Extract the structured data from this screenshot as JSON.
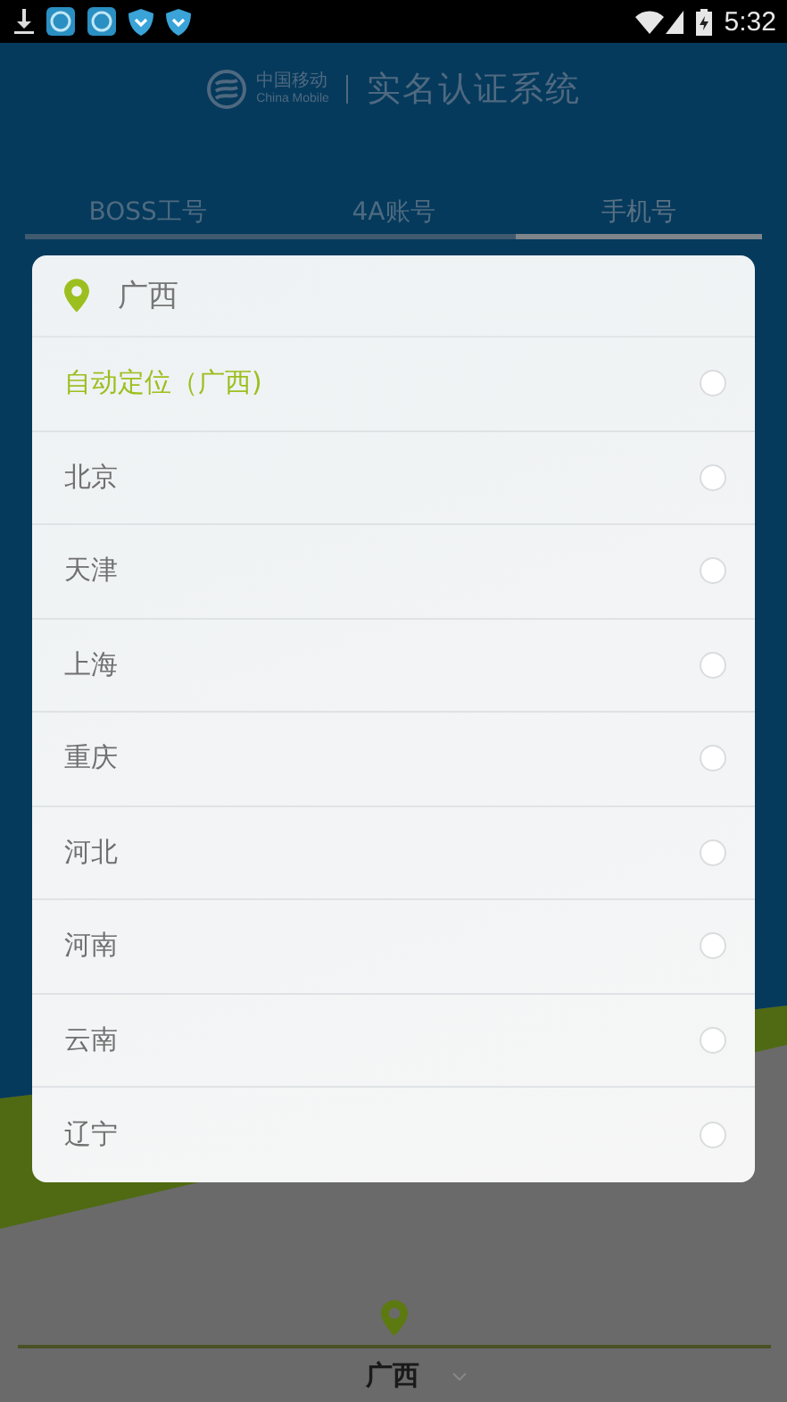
{
  "status_bar": {
    "time": "5:32"
  },
  "header": {
    "brand_cn": "中国移动",
    "brand_en": "China Mobile",
    "title": "实名认证系统"
  },
  "tabs": [
    {
      "label": "BOSS工号",
      "selected": false
    },
    {
      "label": "4A账号",
      "selected": false
    },
    {
      "label": "手机号",
      "selected": true
    }
  ],
  "province_dialog": {
    "current": "广西",
    "options": [
      {
        "label": "自动定位（广西)",
        "kind": "auto",
        "selected": false
      },
      {
        "label": "北京",
        "kind": "province",
        "selected": false
      },
      {
        "label": "天津",
        "kind": "province",
        "selected": false
      },
      {
        "label": "上海",
        "kind": "province",
        "selected": false
      },
      {
        "label": "重庆",
        "kind": "province",
        "selected": false
      },
      {
        "label": "河北",
        "kind": "province",
        "selected": false
      },
      {
        "label": "河南",
        "kind": "province",
        "selected": false
      },
      {
        "label": "云南",
        "kind": "province",
        "selected": false
      },
      {
        "label": "辽宁",
        "kind": "province",
        "selected": false
      }
    ]
  },
  "location_field": {
    "value": "广西"
  }
}
